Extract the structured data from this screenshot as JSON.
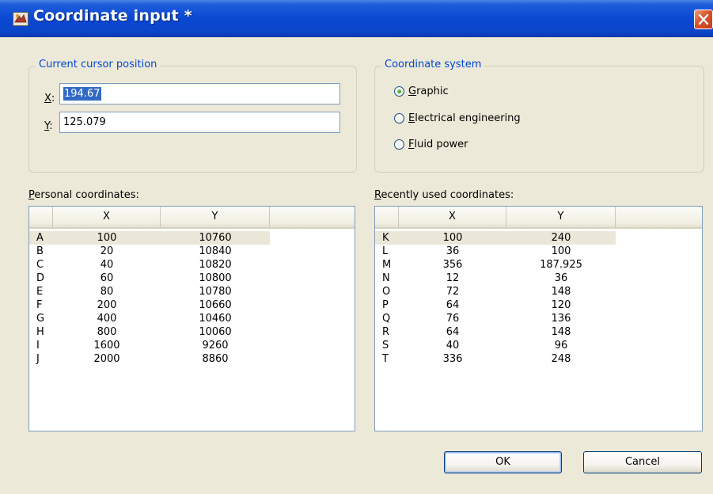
{
  "window": {
    "title": "Coordinate input *"
  },
  "cursor_group": {
    "legend": "Current cursor position",
    "x_label_ul": "X",
    "x_label_rest": ":",
    "x_value": "194.67",
    "y_label_ul": "Y",
    "y_label_rest": ":",
    "y_value": "125.079"
  },
  "coord_system": {
    "legend": "Coordinate system",
    "options": [
      {
        "ul": "G",
        "rest": "raphic",
        "checked": true
      },
      {
        "ul": "E",
        "rest": "lectrical engineering",
        "checked": false
      },
      {
        "ul": "F",
        "rest": "luid power",
        "checked": false
      }
    ]
  },
  "personal": {
    "label_ul": "P",
    "label_rest": "ersonal coordinates:",
    "columns": [
      "",
      "X",
      "Y"
    ],
    "rows": [
      {
        "name": "A",
        "x": "100",
        "y": "10760"
      },
      {
        "name": "B",
        "x": "20",
        "y": "10840"
      },
      {
        "name": "C",
        "x": "40",
        "y": "10820"
      },
      {
        "name": "D",
        "x": "60",
        "y": "10800"
      },
      {
        "name": "E",
        "x": "80",
        "y": "10780"
      },
      {
        "name": "F",
        "x": "200",
        "y": "10660"
      },
      {
        "name": "G",
        "x": "400",
        "y": "10460"
      },
      {
        "name": "H",
        "x": "800",
        "y": "10060"
      },
      {
        "name": "I",
        "x": "1600",
        "y": "9260"
      },
      {
        "name": "J",
        "x": "2000",
        "y": "8860"
      }
    ]
  },
  "recent": {
    "label_ul": "R",
    "label_rest": "ecently used coordinates:",
    "columns": [
      "",
      "X",
      "Y"
    ],
    "rows": [
      {
        "name": "K",
        "x": "100",
        "y": "240"
      },
      {
        "name": "L",
        "x": "36",
        "y": "100"
      },
      {
        "name": "M",
        "x": "356",
        "y": "187.925"
      },
      {
        "name": "N",
        "x": "12",
        "y": "36"
      },
      {
        "name": "O",
        "x": "72",
        "y": "148"
      },
      {
        "name": "P",
        "x": "64",
        "y": "120"
      },
      {
        "name": "Q",
        "x": "76",
        "y": "136"
      },
      {
        "name": "R",
        "x": "64",
        "y": "148"
      },
      {
        "name": "S",
        "x": "40",
        "y": "96"
      },
      {
        "name": "T",
        "x": "336",
        "y": "248"
      }
    ]
  },
  "buttons": {
    "ok": "OK",
    "cancel": "Cancel"
  },
  "colors": {
    "titlebar": "#0a48d3",
    "group_legend": "#0046d5",
    "selection": "#316ac5",
    "dialog_bg": "#ece9d8"
  }
}
